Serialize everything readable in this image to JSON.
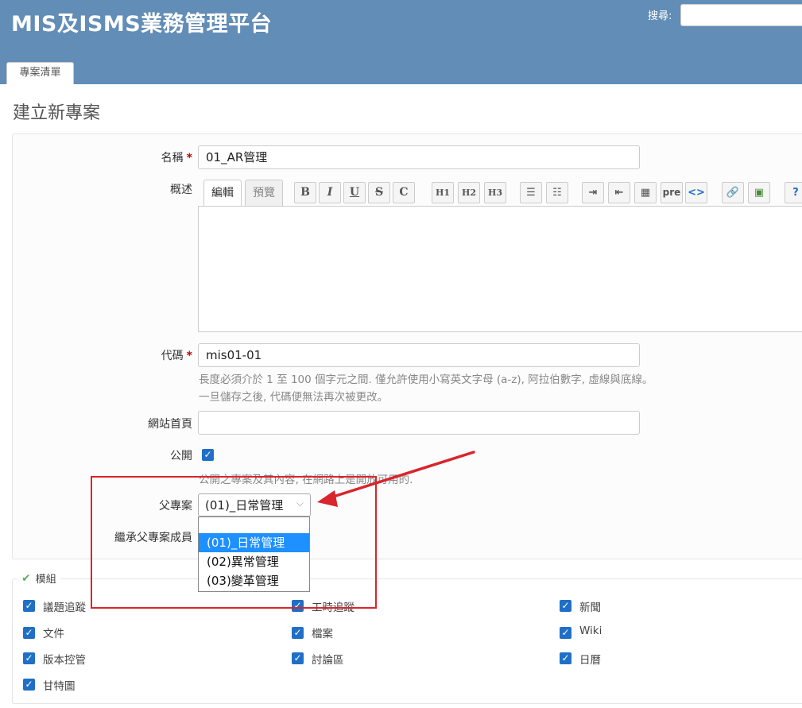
{
  "header": {
    "app_title": "MIS及ISMS業務管理平台",
    "search_label": "搜尋:",
    "search_value": ""
  },
  "tabs": [
    {
      "label": "專案清單"
    }
  ],
  "page": {
    "title": "建立新專案"
  },
  "form": {
    "name": {
      "label": "名稱",
      "required_mark": "*",
      "value": "01_AR管理"
    },
    "description": {
      "label": "概述",
      "tabs": [
        "編輯",
        "預覽"
      ],
      "toolbar": [
        "B",
        "I",
        "U",
        "S",
        "C",
        "H1",
        "H2",
        "H3",
        "ul",
        "ol",
        "indent",
        "outdent",
        "table",
        "pre",
        "<>",
        "link",
        "image",
        "help"
      ]
    },
    "identifier": {
      "label": "代碼",
      "required_mark": "*",
      "value": "mis01-01",
      "hint_line1": "長度必須介於 1 至 100 個字元之間. 僅允許使用小寫英文字母 (a-z), 阿拉伯數字, 虛線與底線。",
      "hint_line2": "一旦儲存之後, 代碼便無法再次被更改。"
    },
    "homepage": {
      "label": "網站首頁",
      "value": ""
    },
    "public": {
      "label": "公開",
      "checked": true,
      "hint": "公開之專案及其內容, 在網路上是開放可用的."
    },
    "parent": {
      "label": "父專案",
      "selected": "(01)_日常管理",
      "options": [
        "",
        "(01)_日常管理",
        "(02)異常管理",
        "(03)變革管理"
      ],
      "highlighted_index": 1
    },
    "inherit_members": {
      "label": "繼承父專案成員"
    }
  },
  "modules": {
    "legend": "模組",
    "items": [
      {
        "label": "議題追蹤",
        "checked": true
      },
      {
        "label": "工時追蹤",
        "checked": true
      },
      {
        "label": "新聞",
        "checked": true
      },
      {
        "label": "文件",
        "checked": true
      },
      {
        "label": "檔案",
        "checked": true
      },
      {
        "label": "Wiki",
        "checked": true
      },
      {
        "label": "版本控管",
        "checked": true
      },
      {
        "label": "討論區",
        "checked": true
      },
      {
        "label": "日曆",
        "checked": true
      },
      {
        "label": "甘特圖",
        "checked": true
      }
    ]
  },
  "colors": {
    "header_bg": "#628db6",
    "checkbox": "#1f6fc7",
    "dropdown_highlight": "#1e90ff",
    "annotation": "#d9252c"
  }
}
